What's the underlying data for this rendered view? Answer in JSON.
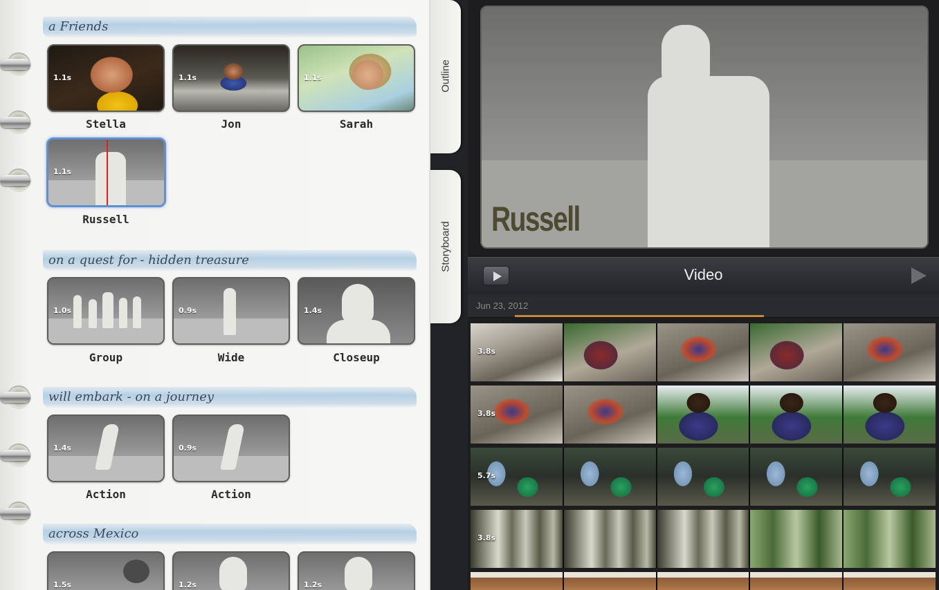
{
  "notebook": {
    "section_top_label": "a Friends",
    "sections": [
      {
        "label": "on a quest for - hidden treasure"
      },
      {
        "label": "will embark - on a journey"
      },
      {
        "label": "across Mexico"
      }
    ],
    "cast": [
      {
        "name": "Stella",
        "duration": "1.1s"
      },
      {
        "name": "Jon",
        "duration": "1.1s"
      },
      {
        "name": "Sarah",
        "duration": "1.1s"
      },
      {
        "name": "Russell",
        "duration": "1.1s",
        "selected": true
      }
    ],
    "shots_quest": [
      {
        "name": "Group",
        "duration": "1.0s"
      },
      {
        "name": "Wide",
        "duration": "0.9s"
      },
      {
        "name": "Closeup",
        "duration": "1.4s"
      }
    ],
    "shots_journey": [
      {
        "name": "Action",
        "duration": "1.4s"
      },
      {
        "name": "Action",
        "duration": "0.9s"
      }
    ],
    "shots_mexico": [
      {
        "duration": "1.5s"
      },
      {
        "duration": "1.2s"
      },
      {
        "duration": "1.2s"
      }
    ]
  },
  "tabs": {
    "outline": "Outline",
    "storyboard": "Storyboard"
  },
  "viewer": {
    "title": "Russell"
  },
  "browser": {
    "title": "Video",
    "date": "Jun 23, 2012",
    "clips": [
      {
        "duration": "3.8s"
      },
      {
        "duration": "3.8s"
      },
      {
        "duration": "5.7s"
      },
      {
        "duration": "3.8s"
      }
    ]
  }
}
